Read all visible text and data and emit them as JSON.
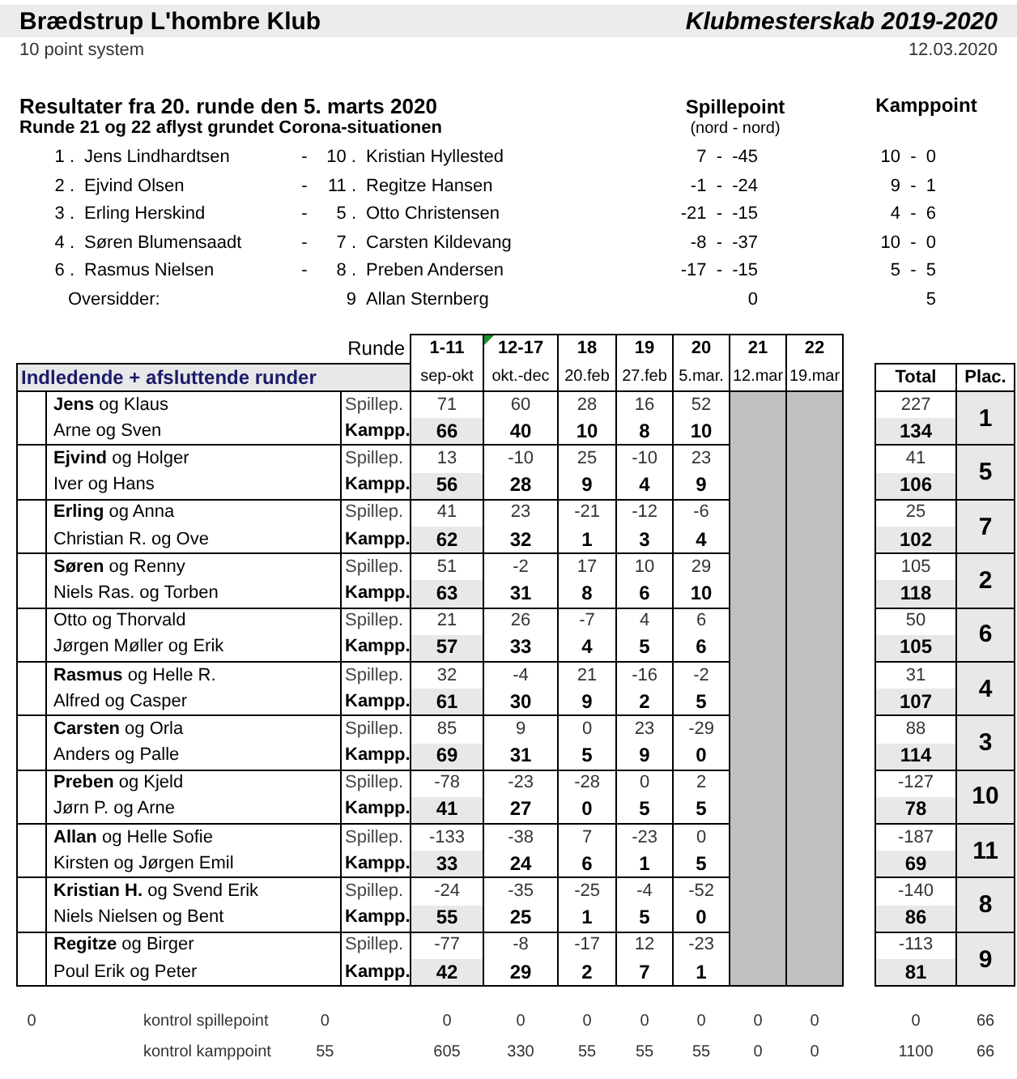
{
  "header": {
    "club": "Brædstrup L'hombre Klub",
    "title": "Klubmesterskab 2019-2020",
    "system": "10 point system",
    "date": "12.03.2020"
  },
  "results": {
    "title": "Resultater fra 20. runde den 5. marts 2020",
    "note": "Runde 21 og 22 aflyst grundet Corona-situationen",
    "spillepoint_heading": "Spillepoint",
    "spillepoint_sub": "(nord - nord)",
    "kamppoint_heading": "Kamppoint",
    "matches": [
      {
        "kind": "match",
        "no1": "1 .",
        "name1": "Jens Lindhardtsen",
        "vs": "-",
        "no2": "10 .",
        "name2": "Kristian Hyllested",
        "spillepoint": "7  -  -45",
        "kamppoint": "10  -  0"
      },
      {
        "kind": "match",
        "no1": "2 .",
        "name1": "Ejvind Olsen",
        "vs": "-",
        "no2": "11 .",
        "name2": "Regitze Hansen",
        "spillepoint": "-1  -  -24",
        "kamppoint": "9  -  1"
      },
      {
        "kind": "match",
        "no1": "3 .",
        "name1": "Erling Herskind",
        "vs": "-",
        "no2": "5 .",
        "name2": "Otto Christensen",
        "spillepoint": "-21  -  -15",
        "kamppoint": "4  -  6"
      },
      {
        "kind": "match",
        "no1": "4 .",
        "name1": "Søren Blumensaadt",
        "vs": "-",
        "no2": "7 .",
        "name2": "Carsten Kildevang",
        "spillepoint": "-8  -  -37",
        "kamppoint": "10  -  0"
      },
      {
        "kind": "match",
        "no1": "6 .",
        "name1": "Rasmus Nielsen",
        "vs": "-",
        "no2": "8 .",
        "name2": "Preben Andersen",
        "spillepoint": "-17  -  -15",
        "kamppoint": "5  -  5"
      },
      {
        "kind": "bye",
        "label": "Oversidder:",
        "no2": "9",
        "name2": "Allan Sternberg",
        "spillepoint": "0",
        "kamppoint": "5"
      }
    ]
  },
  "table": {
    "runde_label": "Runde",
    "section_label": "Indledende + afsluttende runder",
    "total_heading": "Total",
    "place_heading": "Plac.",
    "rounds": [
      {
        "round": "1-11",
        "dates": "sep-okt",
        "cancelled": false
      },
      {
        "round": "12-17",
        "dates": "okt.-dec",
        "cancelled": false
      },
      {
        "round": "18",
        "dates": "20.feb",
        "cancelled": false
      },
      {
        "round": "19",
        "dates": "27.feb",
        "cancelled": false
      },
      {
        "round": "20",
        "dates": "5.mar.",
        "cancelled": false
      },
      {
        "round": "21",
        "dates": "12.mar",
        "cancelled": true
      },
      {
        "round": "22",
        "dates": "19.mar",
        "cancelled": true
      }
    ],
    "teams": [
      {
        "pair1": "**Jens** og Klaus",
        "pair2": "Arne og Sven",
        "spil_label": "Spillep.",
        "kamp_label": "Kampp.",
        "spil": [
          "71",
          "60",
          "28",
          "16",
          "52"
        ],
        "kamp": [
          "66",
          "40",
          "10",
          "8",
          "10"
        ],
        "total_spil": "227",
        "total_kamp": "134",
        "place": "1"
      },
      {
        "pair1": "**Ejvind** og Holger",
        "pair2": "Iver og Hans",
        "spil_label": "Spillep.",
        "kamp_label": "Kampp.",
        "spil": [
          "13",
          "-10",
          "25",
          "-10",
          "23"
        ],
        "kamp": [
          "56",
          "28",
          "9",
          "4",
          "9"
        ],
        "total_spil": "41",
        "total_kamp": "106",
        "place": "5"
      },
      {
        "pair1": "**Erling** og Anna",
        "pair2": "Christian R. og Ove",
        "spil_label": "Spillep.",
        "kamp_label": "Kampp.",
        "spil": [
          "41",
          "23",
          "-21",
          "-12",
          "-6"
        ],
        "kamp": [
          "62",
          "32",
          "1",
          "3",
          "4"
        ],
        "total_spil": "25",
        "total_kamp": "102",
        "place": "7"
      },
      {
        "pair1": "**Søren** og Renny",
        "pair2": "Niels Ras. og Torben",
        "spil_label": "Spillep.",
        "kamp_label": "Kampp.",
        "spil": [
          "51",
          "-2",
          "17",
          "10",
          "29"
        ],
        "kamp": [
          "63",
          "31",
          "8",
          "6",
          "10"
        ],
        "total_spil": "105",
        "total_kamp": "118",
        "place": "2"
      },
      {
        "pair1": "Otto og Thorvald",
        "pair2": "Jørgen Møller og Erik",
        "spil_label": "Spillep.",
        "kamp_label": "Kampp.",
        "spil": [
          "21",
          "26",
          "-7",
          "4",
          "6"
        ],
        "kamp": [
          "57",
          "33",
          "4",
          "5",
          "6"
        ],
        "total_spil": "50",
        "total_kamp": "105",
        "place": "6"
      },
      {
        "pair1": "**Rasmus** og Helle R.",
        "pair2": "Alfred og Casper",
        "spil_label": "Spillep.",
        "kamp_label": "Kampp.",
        "spil": [
          "32",
          "-4",
          "21",
          "-16",
          "-2"
        ],
        "kamp": [
          "61",
          "30",
          "9",
          "2",
          "5"
        ],
        "total_spil": "31",
        "total_kamp": "107",
        "place": "4"
      },
      {
        "pair1": "**Carsten** og Orla",
        "pair2": "Anders og Palle",
        "spil_label": "Spillep.",
        "kamp_label": "Kampp.",
        "spil": [
          "85",
          "9",
          "0",
          "23",
          "-29"
        ],
        "kamp": [
          "69",
          "31",
          "5",
          "9",
          "0"
        ],
        "total_spil": "88",
        "total_kamp": "114",
        "place": "3"
      },
      {
        "pair1": "**Preben** og Kjeld",
        "pair2": "Jørn P. og Arne",
        "spil_label": "Spillep.",
        "kamp_label": "Kampp.",
        "spil": [
          "-78",
          "-23",
          "-28",
          "0",
          "2"
        ],
        "kamp": [
          "41",
          "27",
          "0",
          "5",
          "5"
        ],
        "total_spil": "-127",
        "total_kamp": "78",
        "place": "10"
      },
      {
        "pair1": "**Allan** og Helle Sofie",
        "pair2": "Kirsten og Jørgen Emil",
        "spil_label": "Spillep.",
        "kamp_label": "Kampp.",
        "spil": [
          "-133",
          "-38",
          "7",
          "-23",
          "0"
        ],
        "kamp": [
          "33",
          "24",
          "6",
          "1",
          "5"
        ],
        "total_spil": "-187",
        "total_kamp": "69",
        "place": "11"
      },
      {
        "pair1": "**Kristian H.** og Svend Erik",
        "pair2": "Niels Nielsen og Bent",
        "spil_label": "Spillep.",
        "kamp_label": "Kampp.",
        "spil": [
          "-24",
          "-35",
          "-25",
          "-4",
          "-52"
        ],
        "kamp": [
          "55",
          "25",
          "1",
          "5",
          "0"
        ],
        "total_spil": "-140",
        "total_kamp": "86",
        "place": "8"
      },
      {
        "pair1": "**Regitze** og Birger",
        "pair2": "Poul Erik og Peter",
        "spil_label": "Spillep.",
        "kamp_label": "Kampp.",
        "spil": [
          "-77",
          "-8",
          "-17",
          "12",
          "-23"
        ],
        "kamp": [
          "42",
          "29",
          "2",
          "7",
          "1"
        ],
        "total_spil": "-113",
        "total_kamp": "81",
        "place": "9"
      }
    ],
    "footer": [
      {
        "first": "0",
        "label": "kontrol spillepoint",
        "check": "0",
        "values": [
          "0",
          "0",
          "0",
          "0",
          "0",
          "0",
          "0"
        ],
        "total": "0",
        "place": "66"
      },
      {
        "label": "kontrol kamppoint",
        "check": "55",
        "values": [
          "605",
          "330",
          "55",
          "55",
          "55",
          "0",
          "0"
        ],
        "total": "1100",
        "place": "66"
      }
    ]
  }
}
